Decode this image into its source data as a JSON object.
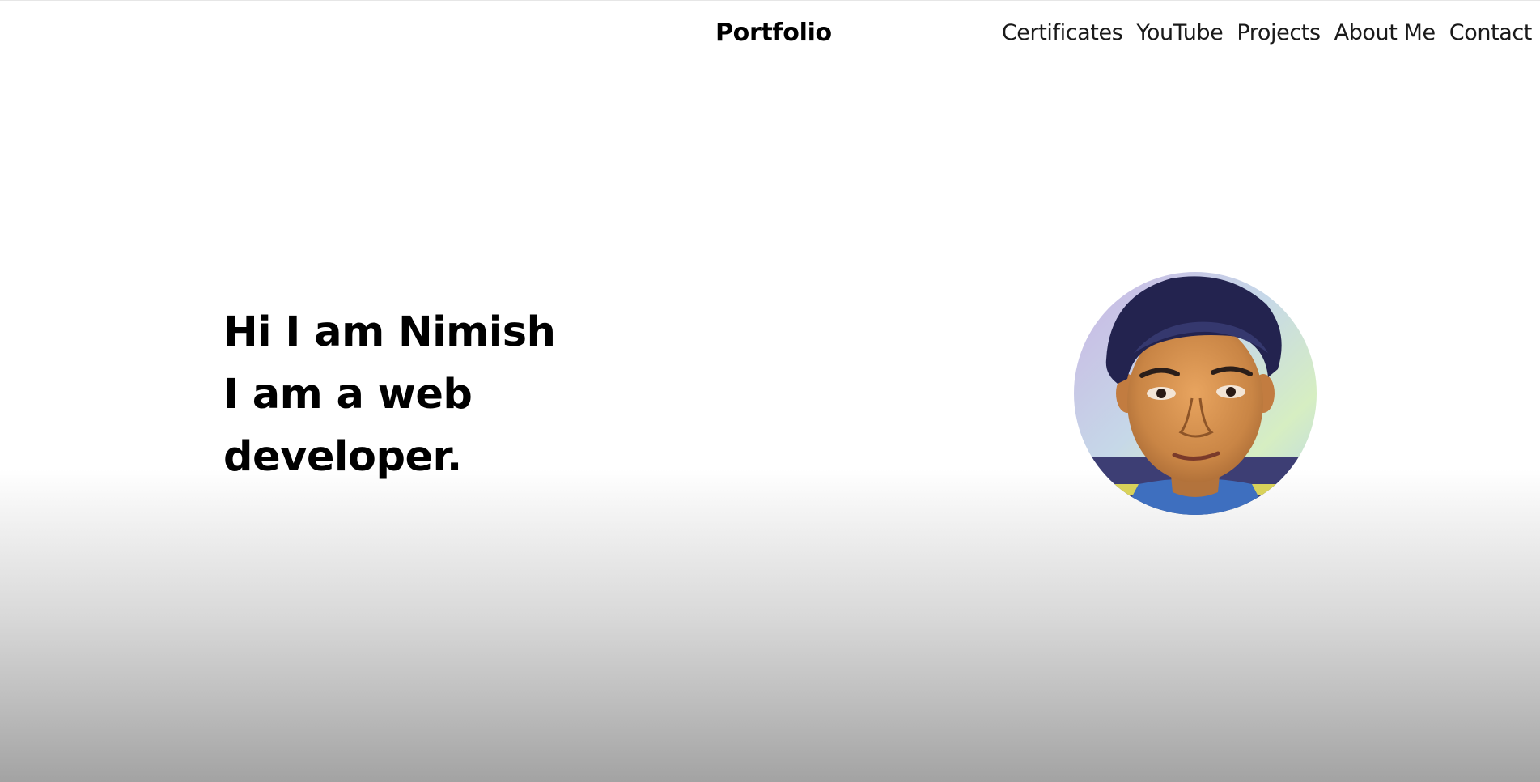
{
  "navbar": {
    "brand": "Portfolio",
    "links": [
      {
        "label": "Certificates"
      },
      {
        "label": "YouTube"
      },
      {
        "label": "Projects"
      },
      {
        "label": "About Me"
      },
      {
        "label": "Contact"
      }
    ]
  },
  "hero": {
    "lines": [
      "Hi I am Nimish",
      "I am a web",
      "developer."
    ]
  },
  "avatar": {
    "icon": "profile-photo-icon"
  }
}
